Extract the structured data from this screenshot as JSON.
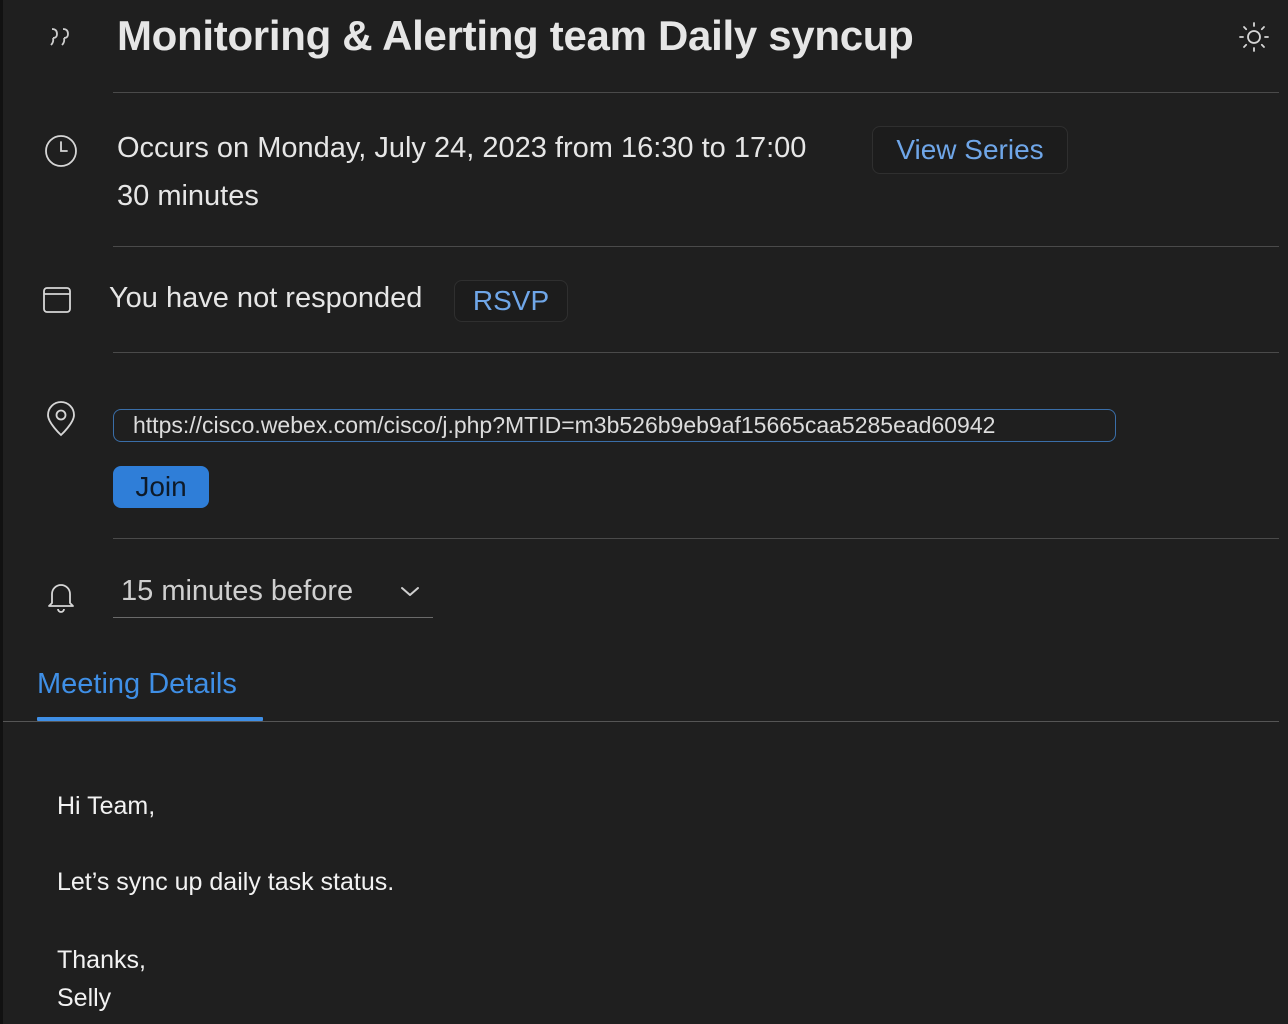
{
  "event": {
    "title": "Monitoring & Alerting team Daily syncup",
    "occurs": "Occurs on Monday, July 24, 2023 from 16:30 to 17:00",
    "duration": "30 minutes",
    "view_series_label": "View Series"
  },
  "response": {
    "status": "You have not responded",
    "rsvp_label": "RSVP"
  },
  "location": {
    "url": "https://cisco.webex.com/cisco/j.php?MTID=m3b526b9eb9af15665caa5285ead60942",
    "join_label": "Join"
  },
  "reminder": {
    "selected": "15 minutes before"
  },
  "tabs": [
    {
      "label": "Meeting Details",
      "active": true
    }
  ],
  "details": {
    "greeting": "Hi Team,",
    "message": "Let’s sync up daily task status.",
    "closing": "Thanks,",
    "signature": "Selly"
  },
  "icons": {
    "title": "quote-icon",
    "theme": "sun-icon",
    "time": "clock-icon",
    "response": "calendar-icon",
    "location": "location-pin-icon",
    "reminder": "bell-icon",
    "dropdown": "chevron-down-icon"
  },
  "colors": {
    "background": "#1f1f1f",
    "accent": "#3f8fe6",
    "link_button_text": "#6fa6e8",
    "join_button": "#2f7ed8"
  }
}
